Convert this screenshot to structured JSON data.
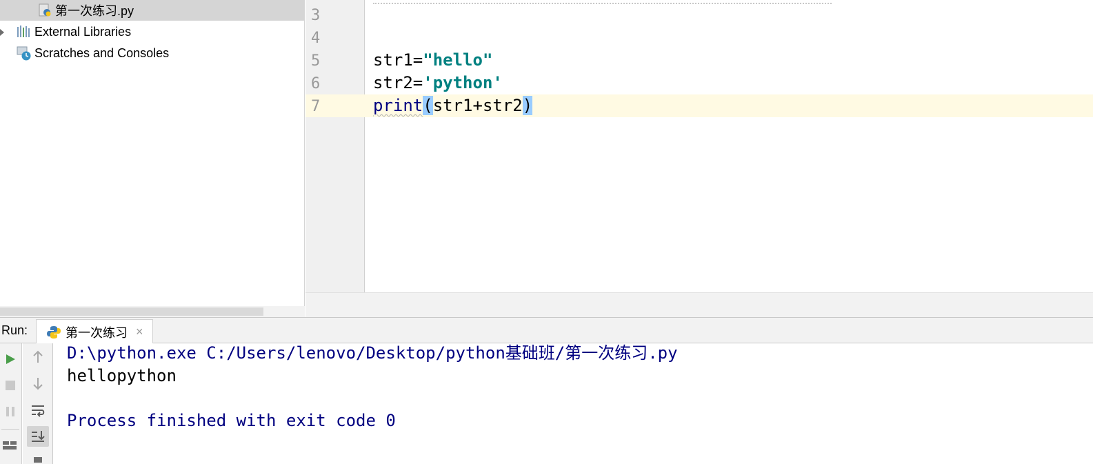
{
  "project_tree": {
    "items": [
      {
        "label": "第一次练习.py",
        "icon": "python-file-icon",
        "selected": true
      },
      {
        "label": "External Libraries",
        "icon": "libraries-icon",
        "expandable": true
      },
      {
        "label": "Scratches and Consoles",
        "icon": "scratches-icon"
      }
    ]
  },
  "editor": {
    "line_numbers": [
      "3",
      "4",
      "5",
      "6",
      "7"
    ],
    "lines": {
      "line5": {
        "var": "str1",
        "op": "=",
        "value": "\"hello\""
      },
      "line6": {
        "var": "str2",
        "op": "=",
        "value": "'python'"
      },
      "line7": {
        "func": "print",
        "open": "(",
        "args": "str1+str2",
        "close": ")"
      }
    }
  },
  "run_panel": {
    "label": "Run:",
    "tab_title": "第一次练习",
    "tab_close": "×",
    "console": {
      "command": "D:\\python.exe C:/Users/lenovo/Desktop/python基础班/第一次练习.py",
      "output": "hellopython",
      "exit_message": "Process finished with exit code 0"
    }
  },
  "colors": {
    "caret_line": "#fffae3",
    "string_teal": "#008080",
    "console_blue": "#000080",
    "brace_highlight": "#99ccff"
  }
}
